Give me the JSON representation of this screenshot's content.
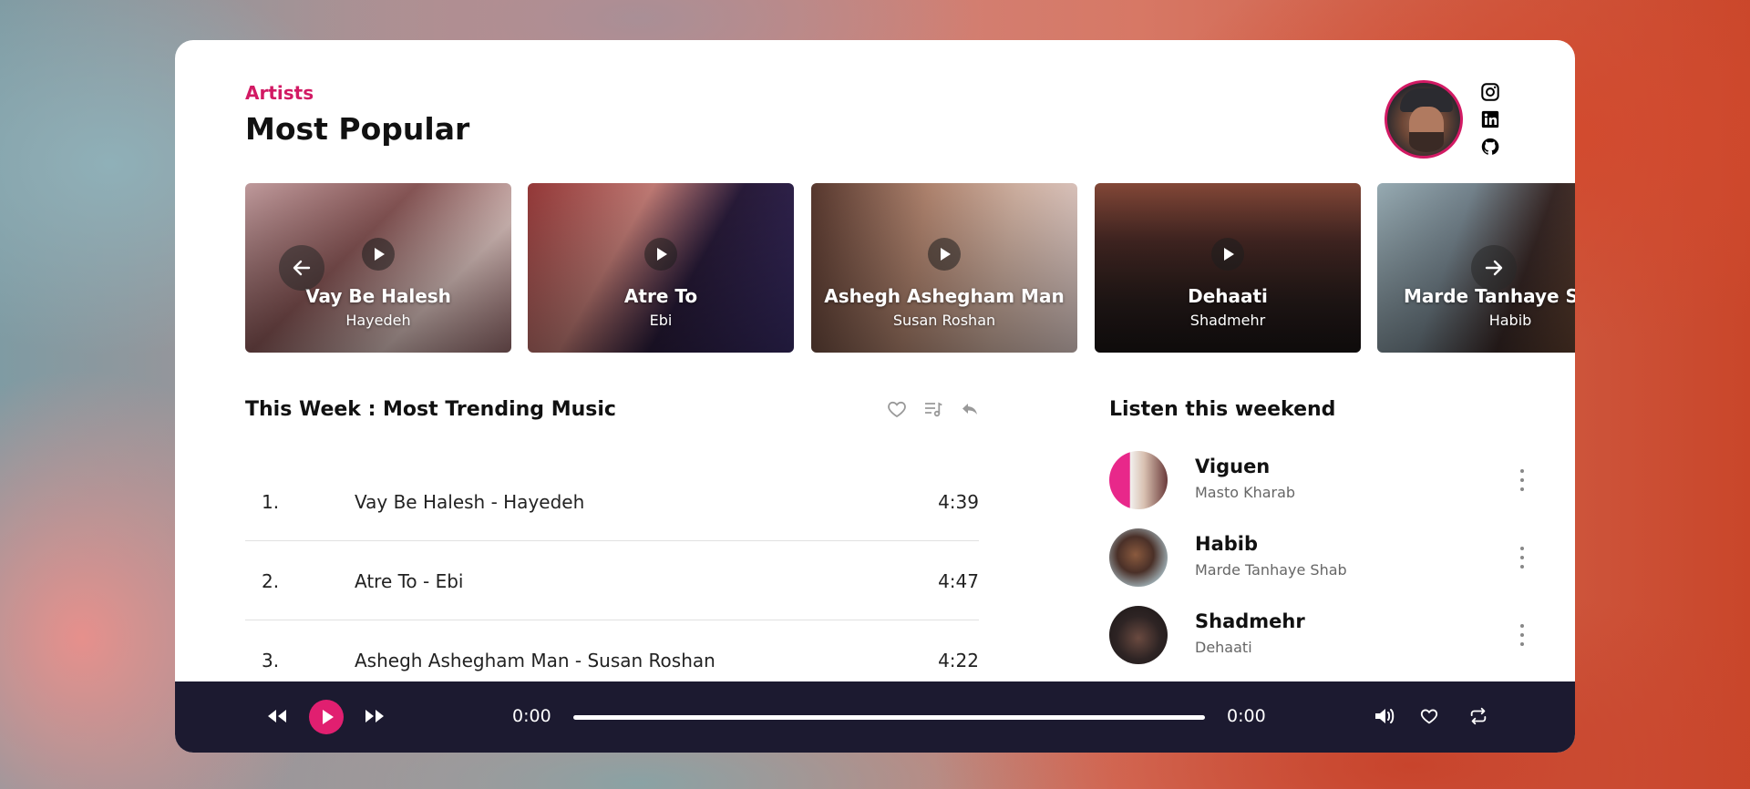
{
  "header": {
    "eyebrow": "Artists",
    "title": "Most Popular"
  },
  "social": [
    "instagram-icon",
    "linkedin-icon",
    "github-icon"
  ],
  "carousel": {
    "albums": [
      {
        "title": "Vay Be Halesh",
        "artist": "Hayedeh"
      },
      {
        "title": "Atre To",
        "artist": "Ebi"
      },
      {
        "title": "Ashegh Ashegham Man",
        "artist": "Susan Roshan"
      },
      {
        "title": "Dehaati",
        "artist": "Shadmehr"
      },
      {
        "title": "Marde Tanhaye Shab",
        "artist": "Habib"
      }
    ]
  },
  "trending": {
    "title": "This Week : Most Trending Music",
    "tracks": [
      {
        "num": "1.",
        "name": "Vay Be Halesh - Hayedeh",
        "duration": "4:39"
      },
      {
        "num": "2.",
        "name": "Atre To - Ebi",
        "duration": "4:47"
      },
      {
        "num": "3.",
        "name": "Ashegh Ashegham Man - Susan Roshan",
        "duration": "4:22"
      }
    ]
  },
  "weekend": {
    "title": "Listen this weekend",
    "items": [
      {
        "artist": "Viguen",
        "song": "Masto Kharab"
      },
      {
        "artist": "Habib",
        "song": "Marde Tanhaye Shab"
      },
      {
        "artist": "Shadmehr",
        "song": "Dehaati"
      }
    ]
  },
  "player": {
    "current_time": "0:00",
    "total_time": "0:00",
    "progress": 0
  },
  "colors": {
    "accent": "#d21a64",
    "player_bg": "#1c1a30"
  }
}
